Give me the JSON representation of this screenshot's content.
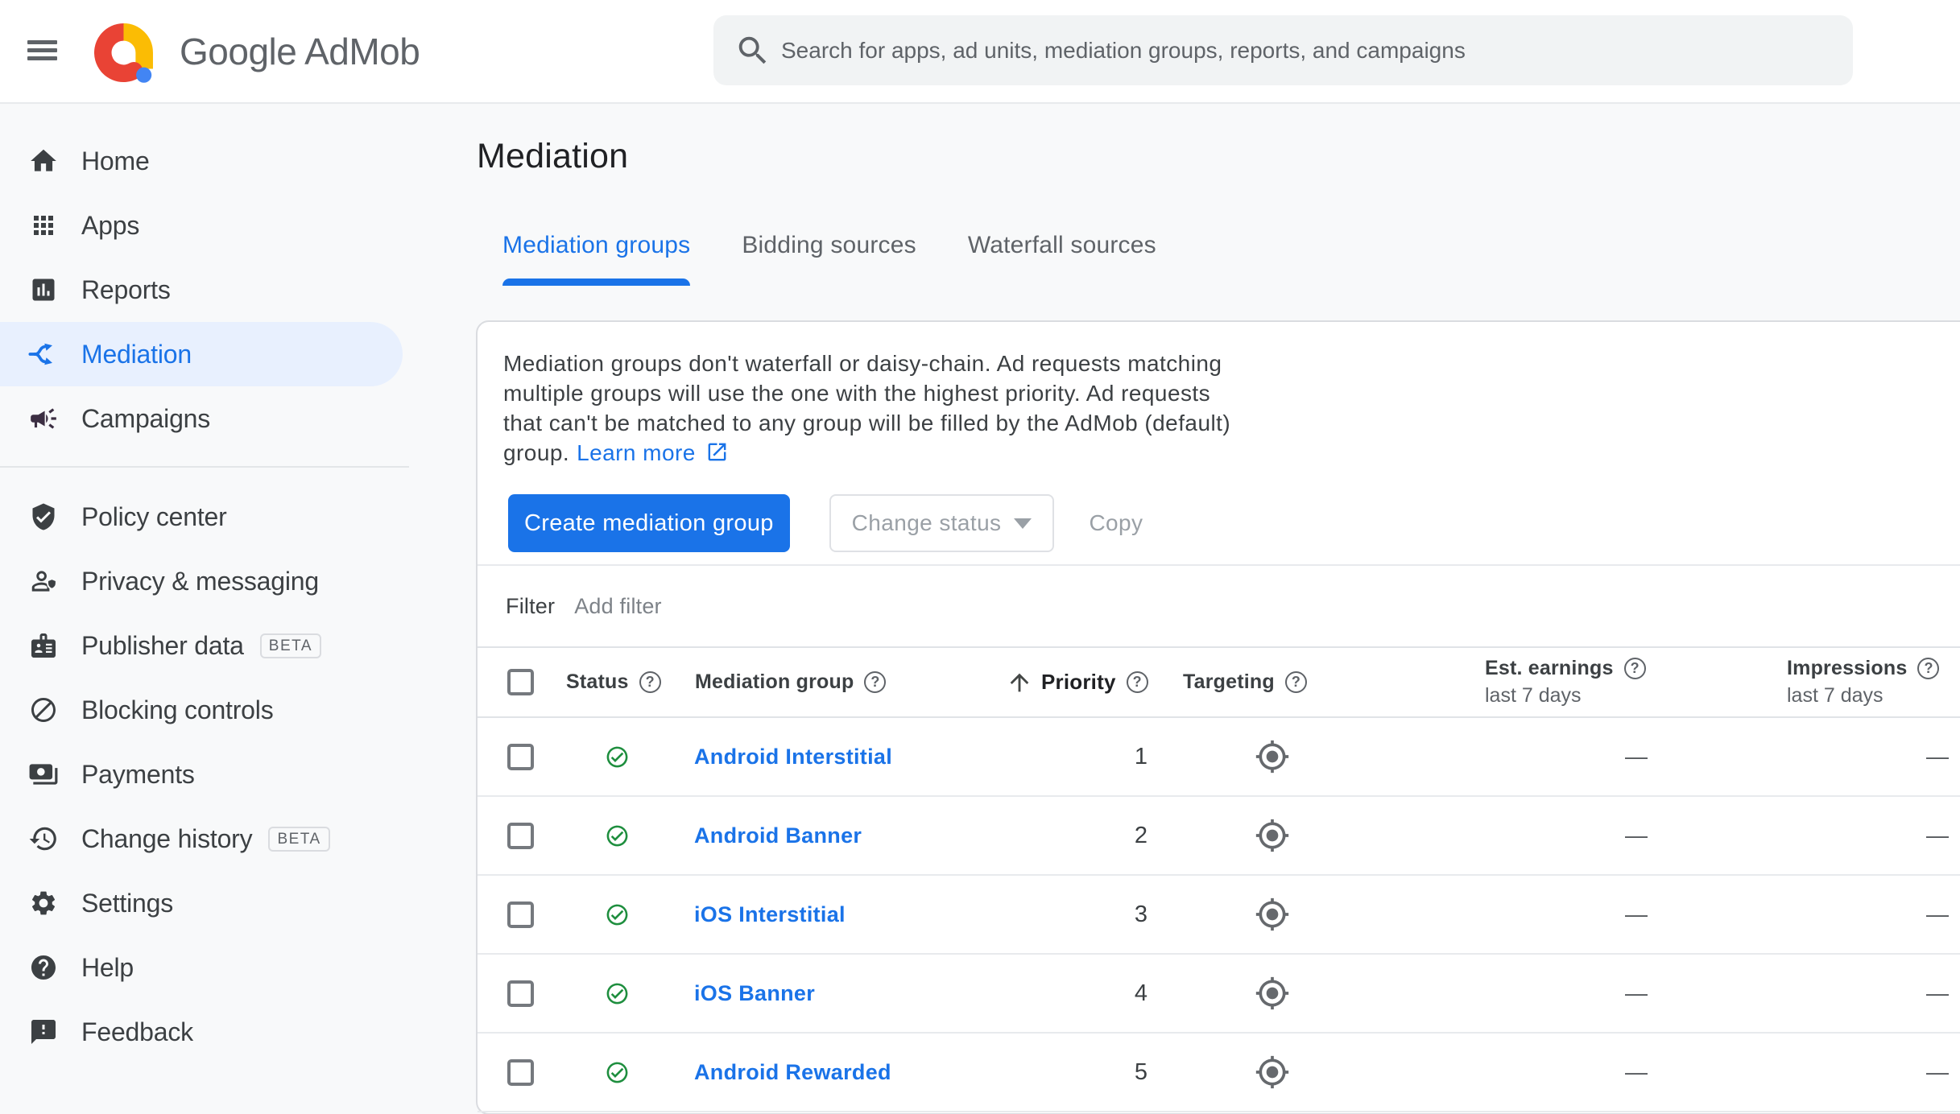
{
  "header": {
    "menu_icon": "hamburger-icon",
    "logo_icon": "admob-logo",
    "brand": "Google AdMob",
    "search_icon": "search-icon",
    "search_placeholder": "Search for apps, ad units, mediation groups, reports, and campaigns",
    "search_value": ""
  },
  "sidebar": {
    "items": [
      {
        "icon": "home-icon",
        "label": "Home",
        "selected": false
      },
      {
        "icon": "apps-icon",
        "label": "Apps",
        "selected": false
      },
      {
        "icon": "reports-icon",
        "label": "Reports",
        "selected": false
      },
      {
        "icon": "mediation-icon",
        "label": "Mediation",
        "selected": true
      },
      {
        "icon": "campaigns-icon",
        "label": "Campaigns",
        "selected": false
      },
      {
        "icon": "policy-center-icon",
        "label": "Policy center",
        "selected": false
      },
      {
        "icon": "privacy-messaging-icon",
        "label": "Privacy & messaging",
        "selected": false
      },
      {
        "icon": "publisher-data-icon",
        "label": "Publisher data",
        "badge": "BETA",
        "selected": false
      },
      {
        "icon": "blocking-controls-icon",
        "label": "Blocking controls",
        "selected": false
      },
      {
        "icon": "payments-icon",
        "label": "Payments",
        "selected": false
      },
      {
        "icon": "change-history-icon",
        "label": "Change history",
        "badge": "BETA",
        "selected": false
      },
      {
        "icon": "settings-icon",
        "label": "Settings",
        "selected": false
      },
      {
        "icon": "help-icon",
        "label": "Help",
        "selected": false
      },
      {
        "icon": "feedback-icon",
        "label": "Feedback",
        "selected": false
      }
    ]
  },
  "main": {
    "title": "Mediation",
    "tabs": [
      {
        "label": "Mediation groups",
        "active": true
      },
      {
        "label": "Bidding sources",
        "active": false
      },
      {
        "label": "Waterfall sources",
        "active": false
      }
    ],
    "notice": {
      "lines": [
        "Mediation groups don't waterfall or daisy-chain. Ad requests matching",
        "multiple groups will use the one with the highest priority. Ad requests",
        "that can't be matched to any group will be filled by the AdMob (default)",
        "group."
      ],
      "learn_more": "Learn more",
      "learn_more_icon": "open-in-new-icon"
    },
    "actions": {
      "create": "Create mediation group",
      "change_status": "Change status",
      "copy": "Copy"
    },
    "filter": {
      "label": "Filter",
      "add": "Add filter"
    },
    "table": {
      "columns": {
        "status": "Status",
        "group": "Mediation group",
        "priority": "Priority",
        "priority_sort": "ascending",
        "targeting": "Targeting",
        "est_earnings": "Est. earnings",
        "impressions": "Impressions",
        "period": "last 7 days"
      },
      "rows": [
        {
          "status": "enabled",
          "name": "Android Interstitial",
          "priority": "1",
          "est_earnings": "—",
          "impressions": "—"
        },
        {
          "status": "enabled",
          "name": "Android Banner",
          "priority": "2",
          "est_earnings": "—",
          "impressions": "—"
        },
        {
          "status": "enabled",
          "name": "iOS Interstitial",
          "priority": "3",
          "est_earnings": "—",
          "impressions": "—"
        },
        {
          "status": "enabled",
          "name": "iOS Banner",
          "priority": "4",
          "est_earnings": "—",
          "impressions": "—"
        },
        {
          "status": "enabled",
          "name": "Android Rewarded",
          "priority": "5",
          "est_earnings": "—",
          "impressions": "—"
        }
      ]
    }
  },
  "colors": {
    "accent_blue": "#1a73e8",
    "selected_pill": "#e8f0fe",
    "status_green": "#1e8e3e",
    "page_background": "#f8f9fa",
    "card_border": "#dadce0",
    "text_primary": "#202124",
    "text_secondary": "#5f6368",
    "disabled_text": "#9aa0a6",
    "logo_red": "#e94335",
    "logo_yellow": "#fbbc04",
    "logo_blue": "#4285f4"
  }
}
